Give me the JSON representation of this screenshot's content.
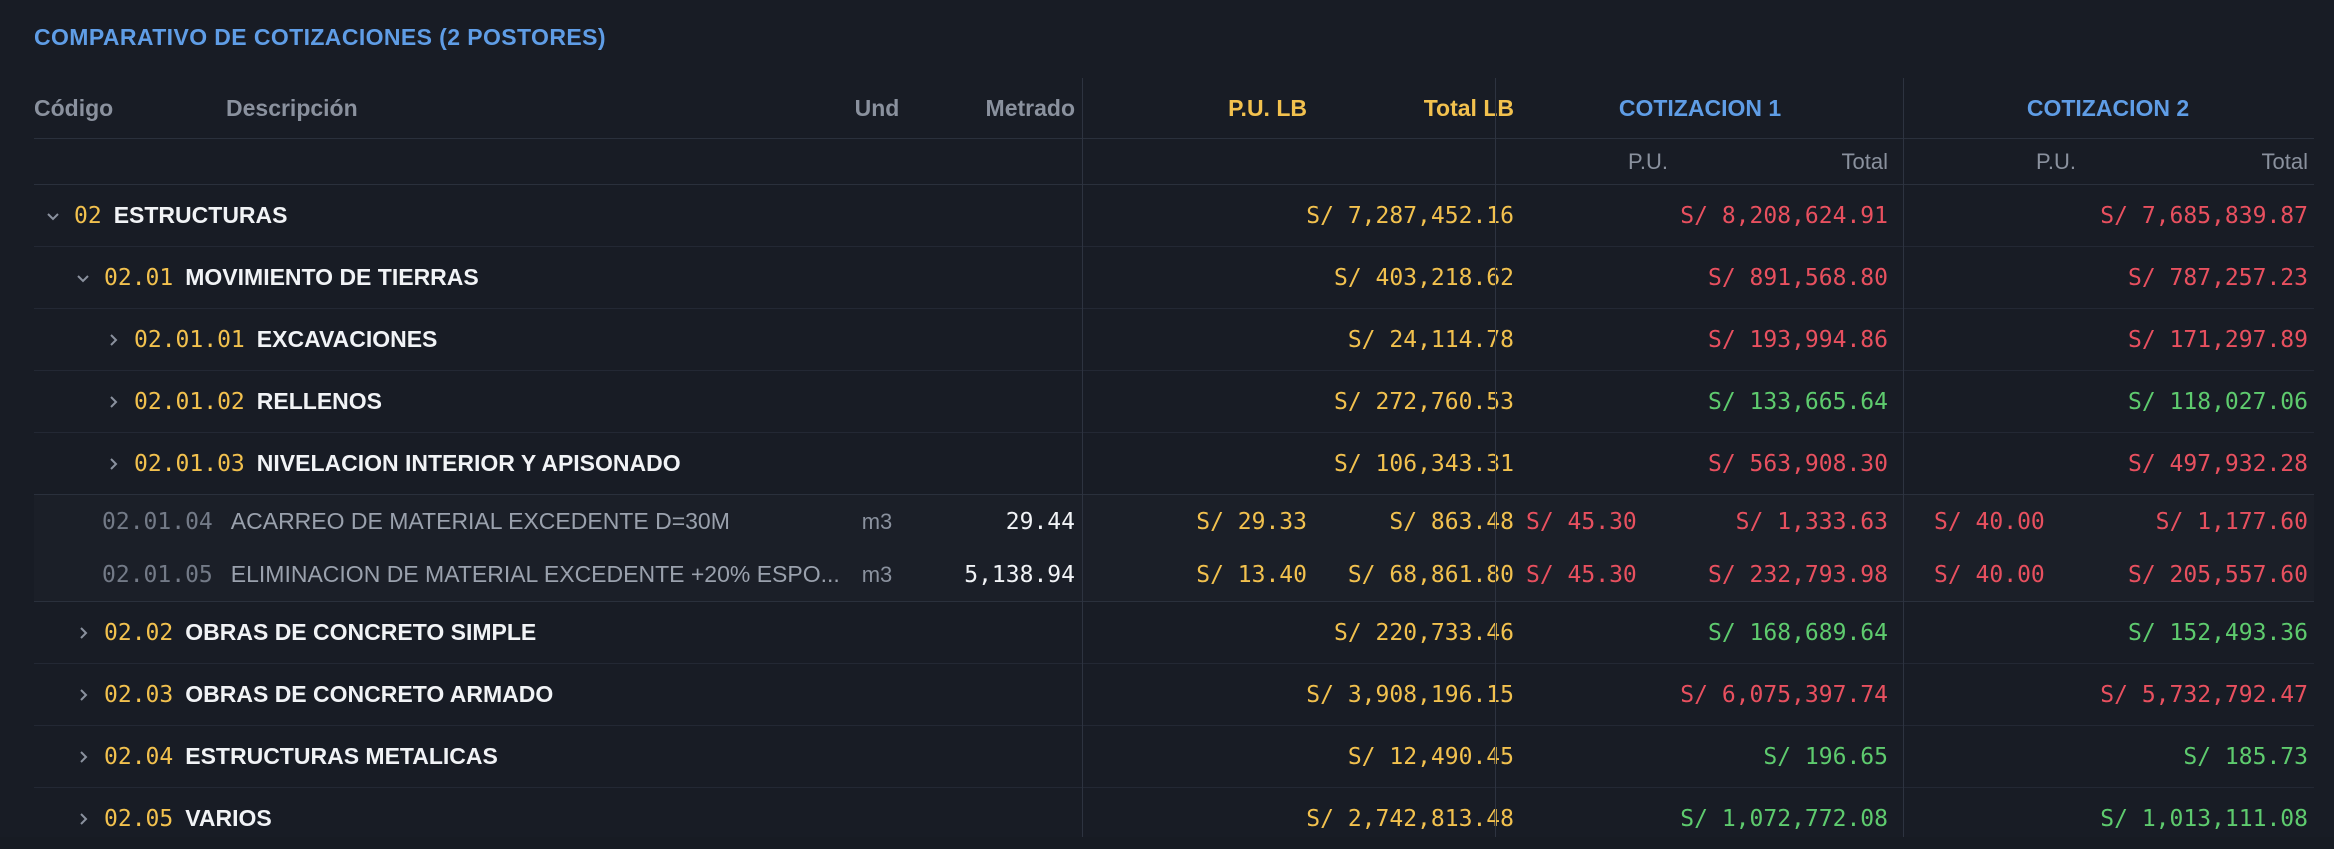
{
  "title": "COMPARATIVO DE COTIZACIONES (2 POSTORES)",
  "headers": {
    "codigo": "Código",
    "descripcion": "Descripción",
    "und": "Und",
    "metrado": "Metrado",
    "pu_lb": "P.U. LB",
    "total_lb": "Total LB",
    "cot1": "COTIZACION 1",
    "cot2": "COTIZACION 2",
    "sub_pu": "P.U.",
    "sub_total": "Total"
  },
  "rows": [
    {
      "code": "02",
      "name": "ESTRUCTURAS",
      "total_lb": "S/ 7,287,452.16",
      "c1_total": "S/ 8,208,624.91",
      "c2_total": "S/ 7,685,839.87",
      "c1_color": "red",
      "c2_color": "red",
      "expanded": true
    },
    {
      "code": "02.01",
      "name": "MOVIMIENTO DE TIERRAS",
      "total_lb": "S/ 403,218.62",
      "c1_total": "S/ 891,568.80",
      "c2_total": "S/ 787,257.23",
      "c1_color": "red",
      "c2_color": "red",
      "expanded": true
    },
    {
      "code": "02.01.01",
      "name": "EXCAVACIONES",
      "total_lb": "S/ 24,114.78",
      "c1_total": "S/ 193,994.86",
      "c2_total": "S/ 171,297.89",
      "c1_color": "red",
      "c2_color": "red",
      "expanded": false
    },
    {
      "code": "02.01.02",
      "name": "RELLENOS",
      "total_lb": "S/ 272,760.53",
      "c1_total": "S/ 133,665.64",
      "c2_total": "S/ 118,027.06",
      "c1_color": "green",
      "c2_color": "green",
      "expanded": false
    },
    {
      "code": "02.01.03",
      "name": "NIVELACION INTERIOR Y APISONADO",
      "total_lb": "S/ 106,343.31",
      "c1_total": "S/ 563,908.30",
      "c2_total": "S/ 497,932.28",
      "c1_color": "red",
      "c2_color": "red",
      "expanded": false
    },
    {
      "code": "02.01.04",
      "name": "ACARREO DE MATERIAL EXCEDENTE D=30M",
      "und": "m3",
      "metrado": "29.44",
      "pu_lb": "S/ 29.33",
      "total_lb": "S/ 863.48",
      "c1_pu": "S/ 45.30",
      "c1_total": "S/ 1,333.63",
      "c2_pu": "S/ 40.00",
      "c2_total": "S/ 1,177.60"
    },
    {
      "code": "02.01.05",
      "name": "ELIMINACION DE MATERIAL EXCEDENTE +20% ESPO...",
      "und": "m3",
      "metrado": "5,138.94",
      "pu_lb": "S/ 13.40",
      "total_lb": "S/ 68,861.80",
      "c1_pu": "S/ 45.30",
      "c1_total": "S/ 232,793.98",
      "c2_pu": "S/ 40.00",
      "c2_total": "S/ 205,557.60"
    },
    {
      "code": "02.02",
      "name": "OBRAS DE CONCRETO SIMPLE",
      "total_lb": "S/ 220,733.46",
      "c1_total": "S/ 168,689.64",
      "c2_total": "S/ 152,493.36",
      "c1_color": "green",
      "c2_color": "green",
      "expanded": false
    },
    {
      "code": "02.03",
      "name": "OBRAS DE CONCRETO ARMADO",
      "total_lb": "S/ 3,908,196.15",
      "c1_total": "S/ 6,075,397.74",
      "c2_total": "S/ 5,732,792.47",
      "c1_color": "red",
      "c2_color": "red",
      "expanded": false
    },
    {
      "code": "02.04",
      "name": "ESTRUCTURAS METALICAS",
      "total_lb": "S/ 12,490.45",
      "c1_total": "S/ 196.65",
      "c2_total": "S/ 185.73",
      "c1_color": "green",
      "c2_color": "green",
      "expanded": false
    },
    {
      "code": "02.05",
      "name": "VARIOS",
      "total_lb": "S/ 2,742,813.48",
      "c1_total": "S/ 1,072,772.08",
      "c2_total": "S/ 1,013,111.08",
      "c1_color": "green",
      "c2_color": "green",
      "expanded": false
    }
  ],
  "colors": {
    "accent": "#5f9de6",
    "baseline": "#f2c14e",
    "over": "#e8505f",
    "under": "#5ecb6e"
  }
}
